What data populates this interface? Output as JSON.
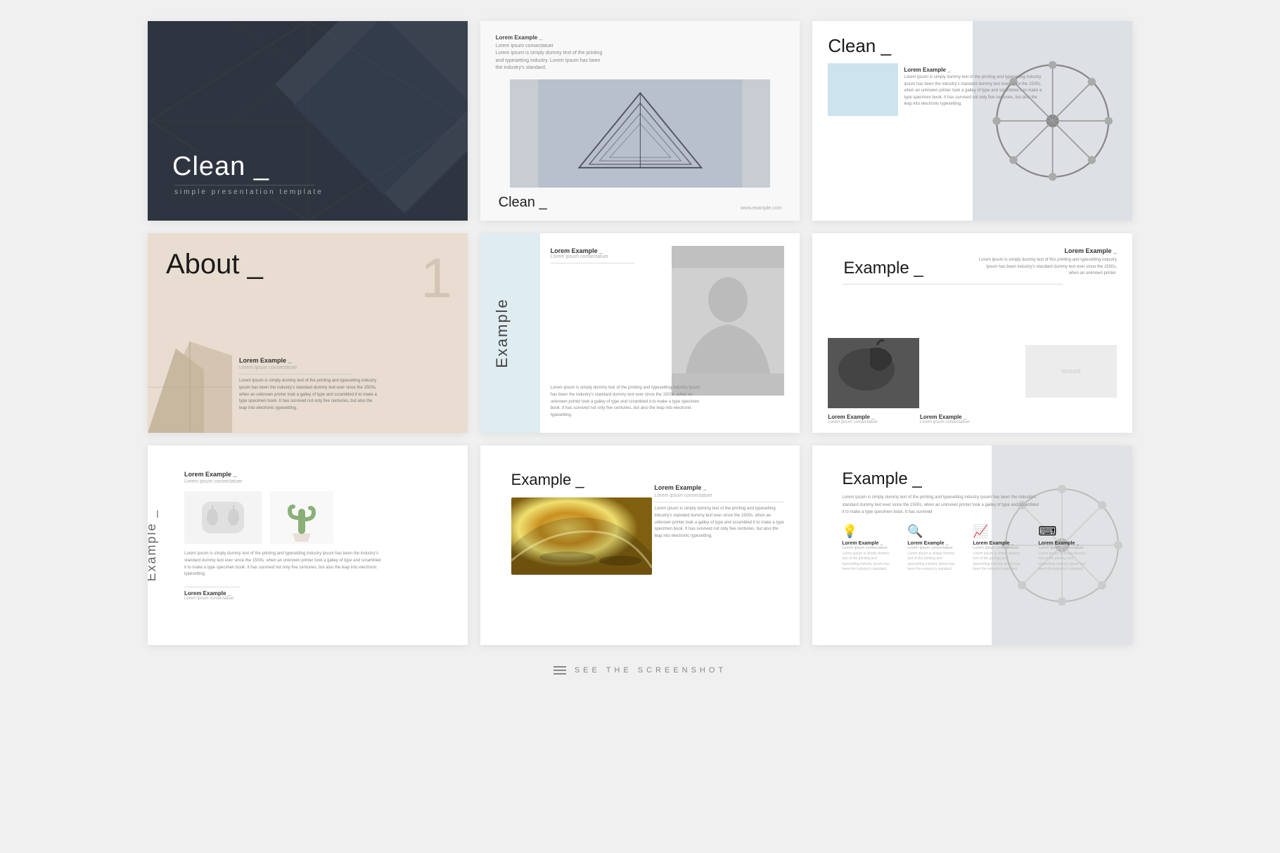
{
  "slides": [
    {
      "id": 1,
      "title": "Clean _",
      "subtitle": "simple presentation template",
      "type": "dark-hero"
    },
    {
      "id": 2,
      "title": "Clean _",
      "url": "www.example.com",
      "caption": "Lorem Example _",
      "caption_sub": "Lorem ipsum consectatuer",
      "body": "Lorem ipsum is simply dummy text of the printing and typesetting industry. Lorem Ipsum has been the industry's standard.",
      "type": "building"
    },
    {
      "id": 3,
      "title": "Clean _",
      "lorem_label": "Lorem Example _",
      "body": "Lorem ipsum is simply dummy text of the printing and typesetting industry ipsum has been the industry's standard dummy text ever since the 1500s, when an unknown printer took a galley of type and scrambled it to make a type specimen book. It has survived not only five centuries, but also the leap into electronic typesetting.",
      "type": "ferris-wheel"
    },
    {
      "id": 4,
      "title": "About _",
      "number": "1",
      "lorem_title": "Lorem Example _",
      "lorem_sub": "Lorem ipsum consectatuer",
      "lorem_body": "Lorem ipsum is simply dummy text of the printing and typesetting industry ipsum has been the industry's standard dummy text ever since the 1500s, when an unknown printer took a galley of type and scrambled it to make a type specimen book. It has survived not only five centuries, but also the leap into electronic typesetting.",
      "type": "about"
    },
    {
      "id": 5,
      "ex_label": "Example",
      "lorem_title": "Lorem Example _",
      "lorem_sub": "Lorem ipsum consectatuer",
      "body": "Lorem ipsum is simply dummy text of the printing and typesetting industry ipsum has been the industry's standard dummy text ever since the 1500s. when an unknown printer took a galley of type and scrambled it to make a type specimen book. It has survived not only five centuries, but also the leap into electronic typesetting.",
      "type": "portrait"
    },
    {
      "id": 6,
      "title": "Example _",
      "right_title": "Lorem Example _",
      "right_body": "Lorem ipsum is simply dummy text of this printing and typesetting industry ipsum has been industry's standard dummy text ever since the 1500s, when an unknown printer.",
      "lorem_b_title": "Lorem Example _",
      "lorem_b_sub": "Lorem ipsum consectatuer",
      "lorem_b2_title": "Lorem Example _",
      "lorem_b2_sub": "Lorem ipsum consectatuer",
      "type": "horse"
    },
    {
      "id": 7,
      "ex_side": "Example _",
      "top_title": "Lorem Example _",
      "top_sub": "Lorem ipsum consectatuer",
      "body": "Lorem ipsum is simply dummy text of the printing and typesetting industry ipsum has been the industry's standard dummy text ever since the 1500s. when an unknown printer took a galley of type and scrambled it to make a type specimen book. It has survived not only five centuries, but also the leap into electronic typesetting.",
      "bot_title": "Lorem Example _",
      "bot_sub": "Lorem ipsum consectatuer",
      "type": "products"
    },
    {
      "id": 8,
      "title": "Example _",
      "right_title": "Lorem Example _",
      "right_sub": "Lorem ipsum consectatuer",
      "right_body": "Lorem ipsum is simply dummy text of the printing and typesetting industry's standard dummy text ever since the 1500s, when an unknown printer took a galley of type and scrambled it to make a type specimen book. It has survived not only five centuries, but also the leap into electronic typesetting.",
      "type": "metallic"
    },
    {
      "id": 9,
      "title": "Example _",
      "body": "Lorem ipsum is simply dummy text of the printing and typesetting industry ipsum has been the industry's standard dummy text ever since the 1500s, when an unknown printer took a galley of type and scrambled it to make a type specimen book. It has survived",
      "icons": [
        {
          "symbol": "💡",
          "title": "Lorem Example _",
          "sub": "Lorem ipsum consectatuer",
          "body": "Lorem ipsum is simply dummy text of the printing and typesetting industry ipsum has been the industry's standard."
        },
        {
          "symbol": "🔍",
          "title": "Lorem Example _",
          "sub": "Lorem ipsum consectatuer",
          "body": "Lorem ipsum is simply dummy text of the printing and typesetting industry ipsum has been the industry's standard."
        },
        {
          "symbol": "📈",
          "title": "Lorem Example _",
          "sub": "Lorem ipsum consectatuer",
          "body": "Lorem ipsum is simply dummy text of the printing and typesetting industry ipsum has been the industry's standard."
        },
        {
          "symbol": "⬡",
          "title": "Lorem Example _",
          "sub": "Lorem ipsum consectatuer",
          "body": "Lorem ipsum is simply dummy text of the printing and typesetting industry ipsum has been the industry's standard."
        }
      ],
      "type": "icons-slide"
    }
  ],
  "footer": {
    "label": "SEE THE SCREENSHOT"
  }
}
